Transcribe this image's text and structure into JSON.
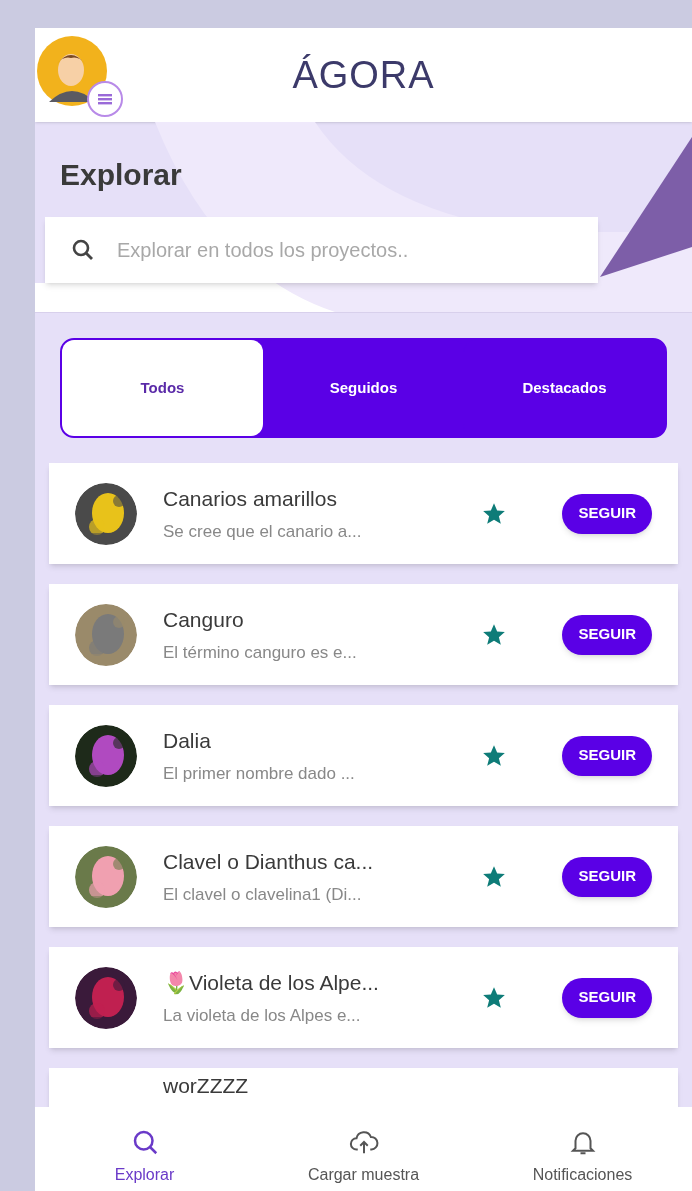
{
  "header": {
    "logo": "ÁGORA"
  },
  "page_title": "Explorar",
  "search": {
    "placeholder": "Explorar en todos los proyectos.."
  },
  "tabs": [
    {
      "label": "Todos",
      "selected": true
    },
    {
      "label": "Seguidos",
      "selected": false
    },
    {
      "label": "Destacados",
      "selected": false
    }
  ],
  "projects": [
    {
      "title": "Canarios amarillos",
      "summary": "Se cree que el canario a...",
      "button": "SEGUIR"
    },
    {
      "title": "Canguro",
      "summary": "El término canguro es e...",
      "button": "SEGUIR"
    },
    {
      "title": "Dalia",
      "summary": "El primer nombre dado ...",
      "button": "SEGUIR"
    },
    {
      "title": "Clavel o Dianthus ca...",
      "summary": "El clavel o clavelina1 (Di...",
      "button": "SEGUIR"
    },
    {
      "title": "🌷Violeta de los Alpe...",
      "summary": "La violeta de los Alpes e...",
      "button": "SEGUIR"
    }
  ],
  "partial_project": {
    "title": "worZZZZ"
  },
  "bottom_nav": [
    {
      "label": "Explorar",
      "selected": true
    },
    {
      "label": "Cargar muestra",
      "selected": false
    },
    {
      "label": "Notificaciones",
      "selected": false
    }
  ]
}
